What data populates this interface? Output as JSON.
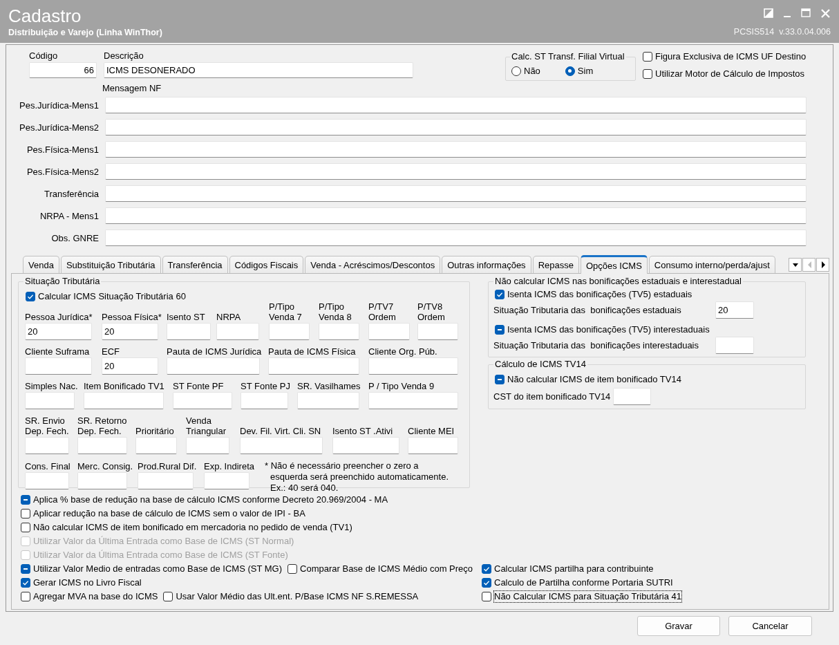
{
  "window": {
    "title": "Cadastro",
    "subtitle": "Distribuição e Varejo (Linha WinThor)",
    "version": "PCSIS514  v.33.0.04.006"
  },
  "header": {
    "codigo": {
      "label": "Código",
      "value": "66"
    },
    "descricao": {
      "label": "Descrição",
      "value": "ICMS DESONERADO"
    },
    "calc_st": {
      "title": "Calc. ST Transf. Filial Virtual",
      "options": [
        {
          "label": "Não",
          "selected": false
        },
        {
          "label": "Sim",
          "selected": true
        }
      ]
    },
    "checkboxes": [
      {
        "label": "Figura Exclusiva de ICMS UF Destino",
        "checked": false
      },
      {
        "label": "Utilizar Motor de Cálculo de Impostos",
        "checked": false
      }
    ]
  },
  "mensagem_nf": {
    "title": "Mensagem NF",
    "fields": [
      {
        "label": "Pes.Jurídica-Mens1"
      },
      {
        "label": "Pes.Jurídica-Mens2"
      },
      {
        "label": "Pes.Física-Mens1"
      },
      {
        "label": "Pes.Física-Mens2"
      },
      {
        "label": "Transferência"
      },
      {
        "label": "NRPA - Mens1"
      },
      {
        "label": "Obs. GNRE"
      }
    ]
  },
  "tabs": [
    {
      "label": "Venda",
      "selected": false
    },
    {
      "label": "Substituição Tributária",
      "selected": false
    },
    {
      "label": "Transferência",
      "selected": false
    },
    {
      "label": "Códigos Fiscais",
      "selected": false
    },
    {
      "label": "Venda - Acréscimos/Descontos",
      "selected": false
    },
    {
      "label": "Outras informações",
      "selected": false
    },
    {
      "label": "Repasse",
      "selected": false
    },
    {
      "label": "Opções ICMS",
      "selected": true
    },
    {
      "label": "Consumo interno/perda/ajust",
      "selected": false
    }
  ],
  "situacao_tributaria": {
    "title": "Situação Tributária",
    "checkbox": {
      "label": "Calcular ICMS Situação Tributária 60",
      "checked": true,
      "mixed": false
    },
    "fields": [
      {
        "label": "Pessoa Jurídica*",
        "value": "20"
      },
      {
        "label": "Pessoa Física*",
        "value": "20"
      },
      {
        "label": "Isento ST"
      },
      {
        "label": "NRPA"
      },
      {
        "label": "P/Tipo\nVenda 7"
      },
      {
        "label": "P/Tipo\nVenda 8"
      },
      {
        "label": "P/TV7\nOrdem"
      },
      {
        "label": "P/TV8\nOrdem"
      },
      {
        "label": "Cliente Suframa"
      },
      {
        "label": "ECF",
        "value": "20"
      },
      {
        "label": "Pauta de ICMS Jurídica"
      },
      {
        "label": "Pauta de ICMS Física"
      },
      {
        "label": "Cliente Org. Púb."
      },
      {
        "label": "Simples Nac."
      },
      {
        "label": "Item Bonificado TV1"
      },
      {
        "label": "ST Fonte PF"
      },
      {
        "label": "ST Fonte PJ"
      },
      {
        "label": "SR. Vasilhames"
      },
      {
        "label": "P / Tipo Venda 9"
      },
      {
        "label": "SR. Envio\nDep. Fech."
      },
      {
        "label": "SR. Retorno\nDep. Fech."
      },
      {
        "label": "Prioritário"
      },
      {
        "label": "Venda\nTriangular"
      },
      {
        "label": "Dev. Fil. Virt. Cli. SN"
      },
      {
        "label": "Isento ST .Ativi"
      },
      {
        "label": "Cliente MEI"
      },
      {
        "label": "Cons. Final"
      },
      {
        "label": "Merc. Consig."
      },
      {
        "label": "Prod.Rural Dif."
      },
      {
        "label": "Exp. Indireta"
      }
    ],
    "note": "* Não é necessário preencher o zero a\nesquerda será preenchido automaticamente.\nEx.: 40 será 040."
  },
  "bonificacoes": {
    "title": "Não calcular ICMS nas bonificações estaduais e interestadual",
    "items": [
      {
        "kind": "checkbox",
        "label": "Isenta ICMS das bonificações (TV5) estaduais",
        "checked": true,
        "mixed": false
      },
      {
        "kind": "field",
        "label": "Situação Tributaria das  bonificações estaduais",
        "value": "20"
      },
      {
        "kind": "checkbox",
        "label": "Isenta ICMS das bonificações (TV5) interestaduais",
        "checked": false,
        "mixed": true
      },
      {
        "kind": "field",
        "label": "Situação Tributaria das  bonificações interestaduais"
      }
    ]
  },
  "tv14": {
    "title": "Cálculo de ICMS TV14",
    "items": [
      {
        "kind": "checkbox",
        "label": "Não calcular ICMS de item bonificado TV14",
        "checked": false,
        "mixed": true
      },
      {
        "kind": "field",
        "label": "CST do item bonificado TV14"
      }
    ]
  },
  "options": {
    "left_rows": [
      [
        {
          "label": "Aplica % base de redução na base de cálculo ICMS conforme Decreto 20.969/2004 - MA",
          "checked": false,
          "mixed": true,
          "disabled": false
        }
      ],
      [
        {
          "label": "Aplicar redução na base de cálculo de ICMS sem o valor de IPI - BA",
          "checked": false,
          "mixed": false,
          "disabled": false
        }
      ],
      [
        {
          "label": "Não calcular ICMS de item bonificado em mercadoria no pedido de venda (TV1)",
          "checked": false,
          "mixed": false,
          "disabled": false
        }
      ],
      [
        {
          "label": "Utilizar Valor da Última Entrada como Base de ICMS (ST Normal)",
          "checked": false,
          "mixed": false,
          "disabled": true
        }
      ],
      [
        {
          "label": "Utilizar Valor da Última Entrada como Base de ICMS (ST Fonte)",
          "checked": false,
          "mixed": false,
          "disabled": true
        }
      ],
      [
        {
          "label": "Utilizar Valor Medio de entradas como Base de ICMS (ST MG)",
          "checked": false,
          "mixed": true,
          "disabled": false
        },
        {
          "label": "Comparar Base de ICMS Médio com Preço",
          "checked": false,
          "mixed": false,
          "disabled": false
        }
      ],
      [
        {
          "label": "Gerar ICMS no Livro Fiscal",
          "checked": true,
          "mixed": false,
          "disabled": false
        }
      ],
      [
        {
          "label": "Agregar MVA na base do ICMS",
          "checked": false,
          "mixed": false,
          "disabled": false
        },
        {
          "label": "Usar Valor Médio das Ult.ent. P/Base ICMS NF S.REMESSA",
          "checked": false,
          "mixed": false,
          "disabled": false
        }
      ]
    ],
    "right_column": [
      {
        "label": "Calcular ICMS partilha para contribuinte",
        "checked": true,
        "mixed": false,
        "focused": false
      },
      {
        "label": "Calculo de Partilha conforme Portaria SUTRI",
        "checked": true,
        "mixed": false,
        "focused": false
      },
      {
        "label": "Não Calcular ICMS para Situação Tributária 41",
        "checked": false,
        "mixed": false,
        "focused": true
      }
    ]
  },
  "buttons": [
    "Gravar",
    "Cancelar"
  ]
}
